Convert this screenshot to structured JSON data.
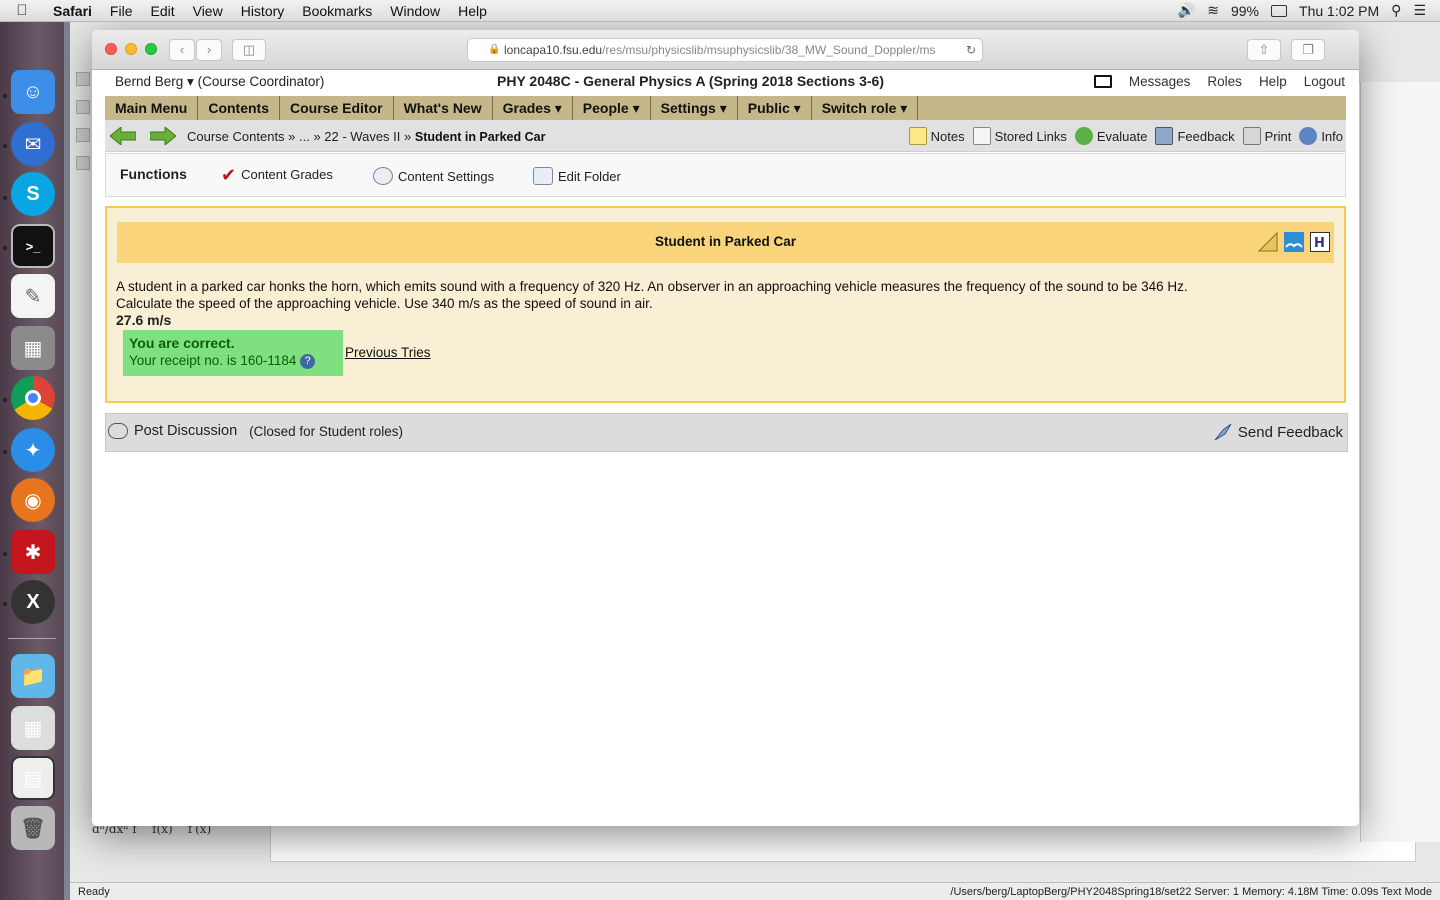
{
  "menubar": {
    "app": "Safari",
    "items": [
      "File",
      "Edit",
      "View",
      "History",
      "Bookmarks",
      "Window",
      "Help"
    ],
    "battery": "99%",
    "clock": "Thu 1:02 PM"
  },
  "browser": {
    "url_host": "loncapa10.fsu.edu",
    "url_path": "/res/msu/physicslib/msuphysicslib/38_MW_Sound_Doppler/ms"
  },
  "header": {
    "user": "Bernd Berg ▾",
    "role": "(Course Coordinator)",
    "course": "PHY 2048C - General Physics A (Spring 2018 Sections 3-6)",
    "links": [
      "Messages",
      "Roles",
      "Help",
      "Logout"
    ]
  },
  "mainnav": [
    "Main Menu",
    "Contents",
    "Course Editor",
    "What's New",
    "Grades ▾",
    "People ▾",
    "Settings ▾",
    "Public ▾",
    "Switch role ▾"
  ],
  "breadcrumb": {
    "part1": "Course Contents » ... » 22 - Waves II »",
    "current": "Student in Parked Car"
  },
  "tools": [
    "Notes",
    "Stored Links",
    "Evaluate",
    "Feedback",
    "Print",
    "Info"
  ],
  "functions": {
    "title": "Functions",
    "content_grades": "Content Grades",
    "content_settings": "Content Settings",
    "edit_folder": "Edit Folder"
  },
  "problem": {
    "title": "Student in Parked Car",
    "text_line1": "A student in a parked car honks the horn, which emits sound with a frequency of 320 Hz. An observer in an approaching vehicle measures the frequency of the sound to be 346 Hz.",
    "text_line2": "Calculate the speed of the approaching vehicle. Use 340 m/s as the speed of sound in air.",
    "answer": "27.6 m/s",
    "correct_msg": "You are correct.",
    "receipt": "Your receipt no. is 160-1184",
    "previous_tries": "Previous Tries"
  },
  "discussion": {
    "post": "Post Discussion",
    "closed": "(Closed for Student roles)",
    "send_feedback": "Send Feedback"
  },
  "statusbar": {
    "left": "Ready",
    "right": "/Users/berg/LaptopBerg/PHY2048Spring18/set22   Server: 1   Memory: 4.18M   Time: 0.09s   Text Mode"
  },
  "colors": {
    "nav_bg": "#c6b78b",
    "problem_header": "#fad47b",
    "problem_border": "#f7c94e",
    "correct_bg": "#7fe07f"
  }
}
